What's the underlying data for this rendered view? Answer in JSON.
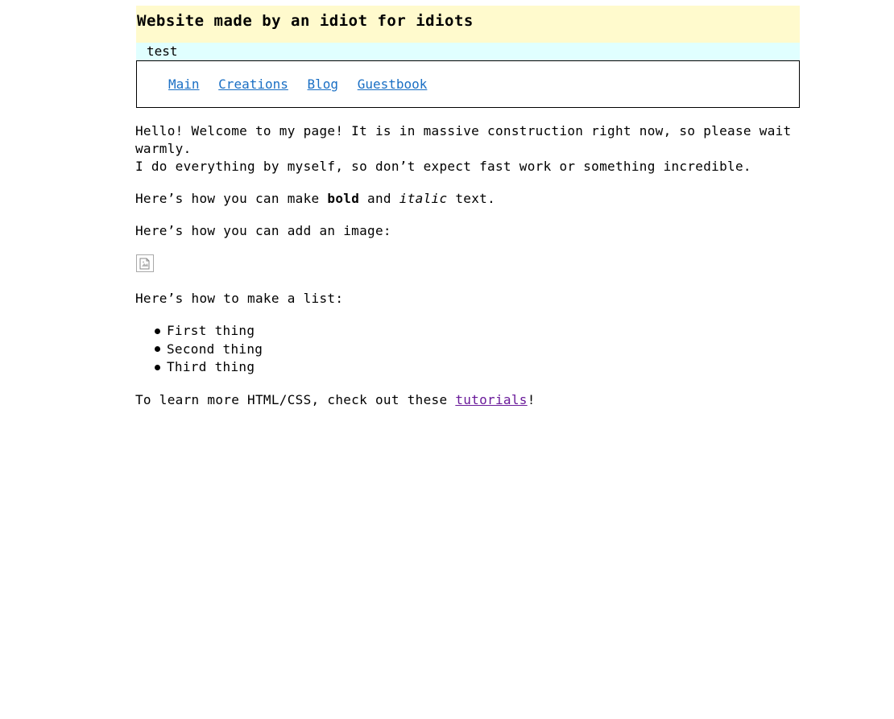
{
  "header": {
    "title": "Website made by an idiot for idiots",
    "subtitle": "test"
  },
  "nav": {
    "items": [
      {
        "label": "Main"
      },
      {
        "label": "Creations"
      },
      {
        "label": "Blog"
      },
      {
        "label": "Guestbook"
      }
    ]
  },
  "content": {
    "welcome_line1": "Hello! Welcome to my page! It is in massive construction right now, so please wait warmly.",
    "welcome_line2": "I do everything by myself, so don’t expect fast work or something incredible.",
    "format_prefix": "Here’s how you can make ",
    "format_bold": "bold",
    "format_middle": " and ",
    "format_italic": "italic",
    "format_suffix": " text.",
    "image_intro": "Here’s how you can add an image:",
    "image_icon": "broken-image-icon",
    "list_intro": "Here’s how to make a list:",
    "list_items": [
      "First thing",
      "Second thing",
      "Third thing"
    ],
    "learn_prefix": "To learn more HTML/CSS, check out these ",
    "learn_link": "tutorials",
    "learn_suffix": "!"
  },
  "colors": {
    "header_bg": "#fffacd",
    "subbar_bg": "#e0ffff",
    "nav_link": "#1a6fc4",
    "visited_link": "#6a1b9a"
  }
}
